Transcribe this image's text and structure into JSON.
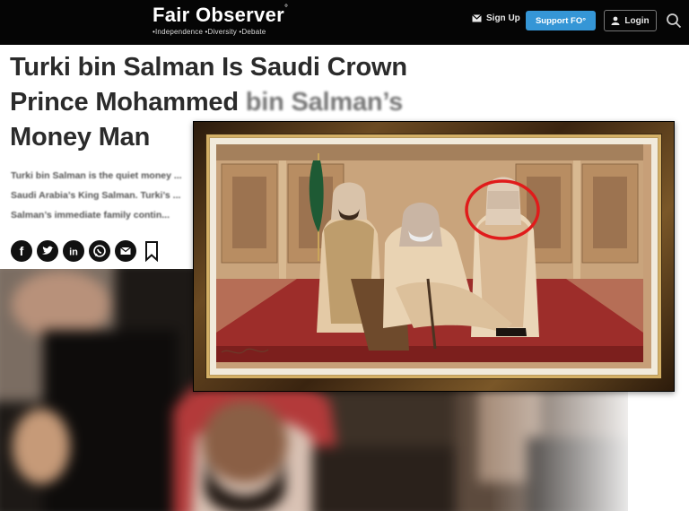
{
  "header": {
    "logo_title": "Fair Observer",
    "logo_mark": "°",
    "tagline": "•Independence •Diversity •Debate",
    "signup_label": "Sign Up",
    "support_label": "Support FO°",
    "login_label": "Login"
  },
  "article": {
    "headline_part1": "Turki bin Salman Is Saudi Crown Prince Mohammed ",
    "headline_part2": "bin Salman’s",
    "headline_part3": " Money Man",
    "summary": "Turki bin Salman is the quiet money ... Saudi Arabia’s King Salman. Turki’s ... Salman’s immediate family contin..."
  },
  "share_icons": [
    "facebook-icon",
    "twitter-icon",
    "linkedin-icon",
    "whatsapp-icon",
    "email-icon",
    "bookmark-icon"
  ],
  "colors": {
    "header_bg": "#050505",
    "support_button": "#3596d6",
    "headline": "#2b2b2b",
    "highlight_circle": "#e01b1b"
  }
}
